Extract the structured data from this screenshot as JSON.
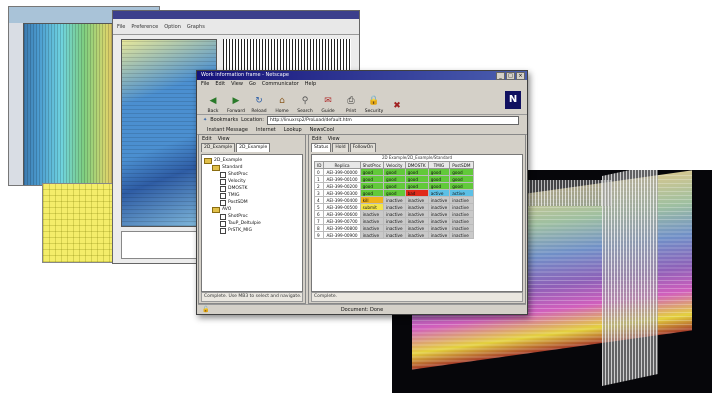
{
  "window": {
    "title": "Work information frame - Netscape",
    "controls": [
      "_",
      "□",
      "×"
    ]
  },
  "menu": [
    "File",
    "Edit",
    "View",
    "Go",
    "Communicator",
    "Help"
  ],
  "toolbar": {
    "buttons": [
      {
        "label": "Back",
        "icon": "back-arrow-icon"
      },
      {
        "label": "Forward",
        "icon": "forward-arrow-icon"
      },
      {
        "label": "Reload",
        "icon": "reload-icon"
      },
      {
        "label": "Home",
        "icon": "home-icon"
      },
      {
        "label": "Search",
        "icon": "search-icon"
      },
      {
        "label": "Guide",
        "icon": "guide-icon"
      },
      {
        "label": "Print",
        "icon": "print-icon"
      },
      {
        "label": "Security",
        "icon": "security-icon"
      },
      {
        "label": "",
        "icon": "stop-icon"
      }
    ]
  },
  "location": {
    "bookmarks_label": "Bookmarks",
    "location_label": "Location:",
    "url": "http://linuxrsp2/ProLoad/default.htm"
  },
  "quicklinks": [
    "Instant Message",
    "Internet",
    "Lookup",
    "NewsCool"
  ],
  "left_pane": {
    "menu": [
      "Edit",
      "View"
    ],
    "tabs": [
      "2D_Example",
      "2D_Example"
    ],
    "tree": [
      {
        "label": "2D_Example",
        "level": 0,
        "type": "root"
      },
      {
        "label": "Standard",
        "level": 1,
        "type": "folder"
      },
      {
        "label": "ShotProc",
        "level": 2,
        "type": "item"
      },
      {
        "label": "Velocity",
        "level": 2,
        "type": "item"
      },
      {
        "label": "DMOSTK",
        "level": 2,
        "type": "item"
      },
      {
        "label": "TMIG",
        "level": 2,
        "type": "item"
      },
      {
        "label": "PostSDM",
        "level": 2,
        "type": "item"
      },
      {
        "label": "AVO",
        "level": 1,
        "type": "folder"
      },
      {
        "label": "ShotProc",
        "level": 2,
        "type": "item"
      },
      {
        "label": "TauP_Deltulpie",
        "level": 2,
        "type": "item"
      },
      {
        "label": "PrSTK_MIG",
        "level": 2,
        "type": "item"
      }
    ],
    "status": "Complete. Use MB3 to select and navigate."
  },
  "right_pane": {
    "menu": [
      "Edit",
      "View"
    ],
    "tabs": [
      "Status",
      "Hold",
      "FollowOn"
    ],
    "grid_title": "2D Example/2D_Example/Standard",
    "columns": [
      "ID",
      "Replica",
      "ShotProc",
      "Velocity",
      "DMOSTK",
      "TMIG",
      "PostSDM"
    ],
    "rows": [
      {
        "id": "0",
        "replica": "AEI-399-00000",
        "cells": [
          "good",
          "good",
          "good",
          "good",
          "good"
        ]
      },
      {
        "id": "1",
        "replica": "AEI-399-00100",
        "cells": [
          "good",
          "good",
          "good",
          "good",
          "good"
        ]
      },
      {
        "id": "2",
        "replica": "AEI-399-00200",
        "cells": [
          "good",
          "good",
          "good",
          "good",
          "good"
        ]
      },
      {
        "id": "3",
        "replica": "AEI-399-00300",
        "cells": [
          "good",
          "good",
          "bad",
          "active",
          "active"
        ]
      },
      {
        "id": "4",
        "replica": "AEI-399-00400",
        "cells": [
          "kill",
          "inactive",
          "inactive",
          "inactive",
          "inactive"
        ]
      },
      {
        "id": "5",
        "replica": "AEI-399-00500",
        "cells": [
          "submit",
          "inactive",
          "inactive",
          "inactive",
          "inactive"
        ]
      },
      {
        "id": "6",
        "replica": "AEI-399-00600",
        "cells": [
          "inactive",
          "inactive",
          "inactive",
          "inactive",
          "inactive"
        ]
      },
      {
        "id": "7",
        "replica": "AEI-399-00700",
        "cells": [
          "inactive",
          "inactive",
          "inactive",
          "inactive",
          "inactive"
        ]
      },
      {
        "id": "8",
        "replica": "AEI-399-00800",
        "cells": [
          "inactive",
          "inactive",
          "inactive",
          "inactive",
          "inactive"
        ]
      },
      {
        "id": "9",
        "replica": "AEI-399-00900",
        "cells": [
          "inactive",
          "inactive",
          "inactive",
          "inactive",
          "inactive"
        ]
      }
    ],
    "status": "Complete."
  },
  "status_bar": "Document: Done",
  "status_colors": {
    "good": "#62c93a",
    "bad": "#e02a1a",
    "active": "#5cc0e6",
    "kill": "#f1b21b",
    "submit": "#f3e44a",
    "inactive": "#c9c9c9"
  },
  "background_windows": {
    "seismic_menu": [
      "File",
      "Preference",
      "Option",
      "Graphs"
    ]
  }
}
